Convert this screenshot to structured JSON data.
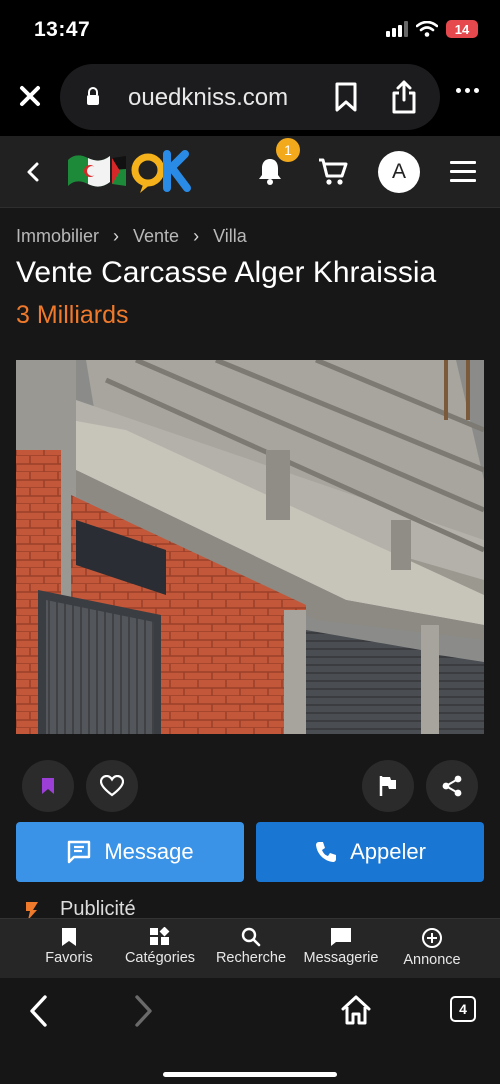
{
  "status": {
    "time": "13:47",
    "battery": "14"
  },
  "browser": {
    "url": "ouedkniss.com",
    "tab_count": "4"
  },
  "header": {
    "notification_count": "1",
    "avatar_initial": "A"
  },
  "breadcrumb": [
    "Immobilier",
    "Vente",
    "Villa"
  ],
  "listing": {
    "title": "Vente Carcasse Alger Khraissia",
    "price": "3 Milliards"
  },
  "actions": {
    "message_label": "Message",
    "call_label": "Appeler"
  },
  "ad": {
    "label": "Publicité"
  },
  "nav": [
    {
      "label": "Favoris",
      "icon": "bookmark-icon"
    },
    {
      "label": "Catégories",
      "icon": "categories-icon"
    },
    {
      "label": "Recherche",
      "icon": "search-icon"
    },
    {
      "label": "Messagerie",
      "icon": "chat-icon"
    },
    {
      "label": "Annonce",
      "icon": "add-circle-icon"
    }
  ],
  "colors": {
    "accent_orange": "#f07a2c",
    "message_blue": "#3b93e8",
    "call_blue": "#1976d2",
    "badge_yellow": "#f2a91c",
    "bookmark_purple": "#9b3fd6"
  }
}
